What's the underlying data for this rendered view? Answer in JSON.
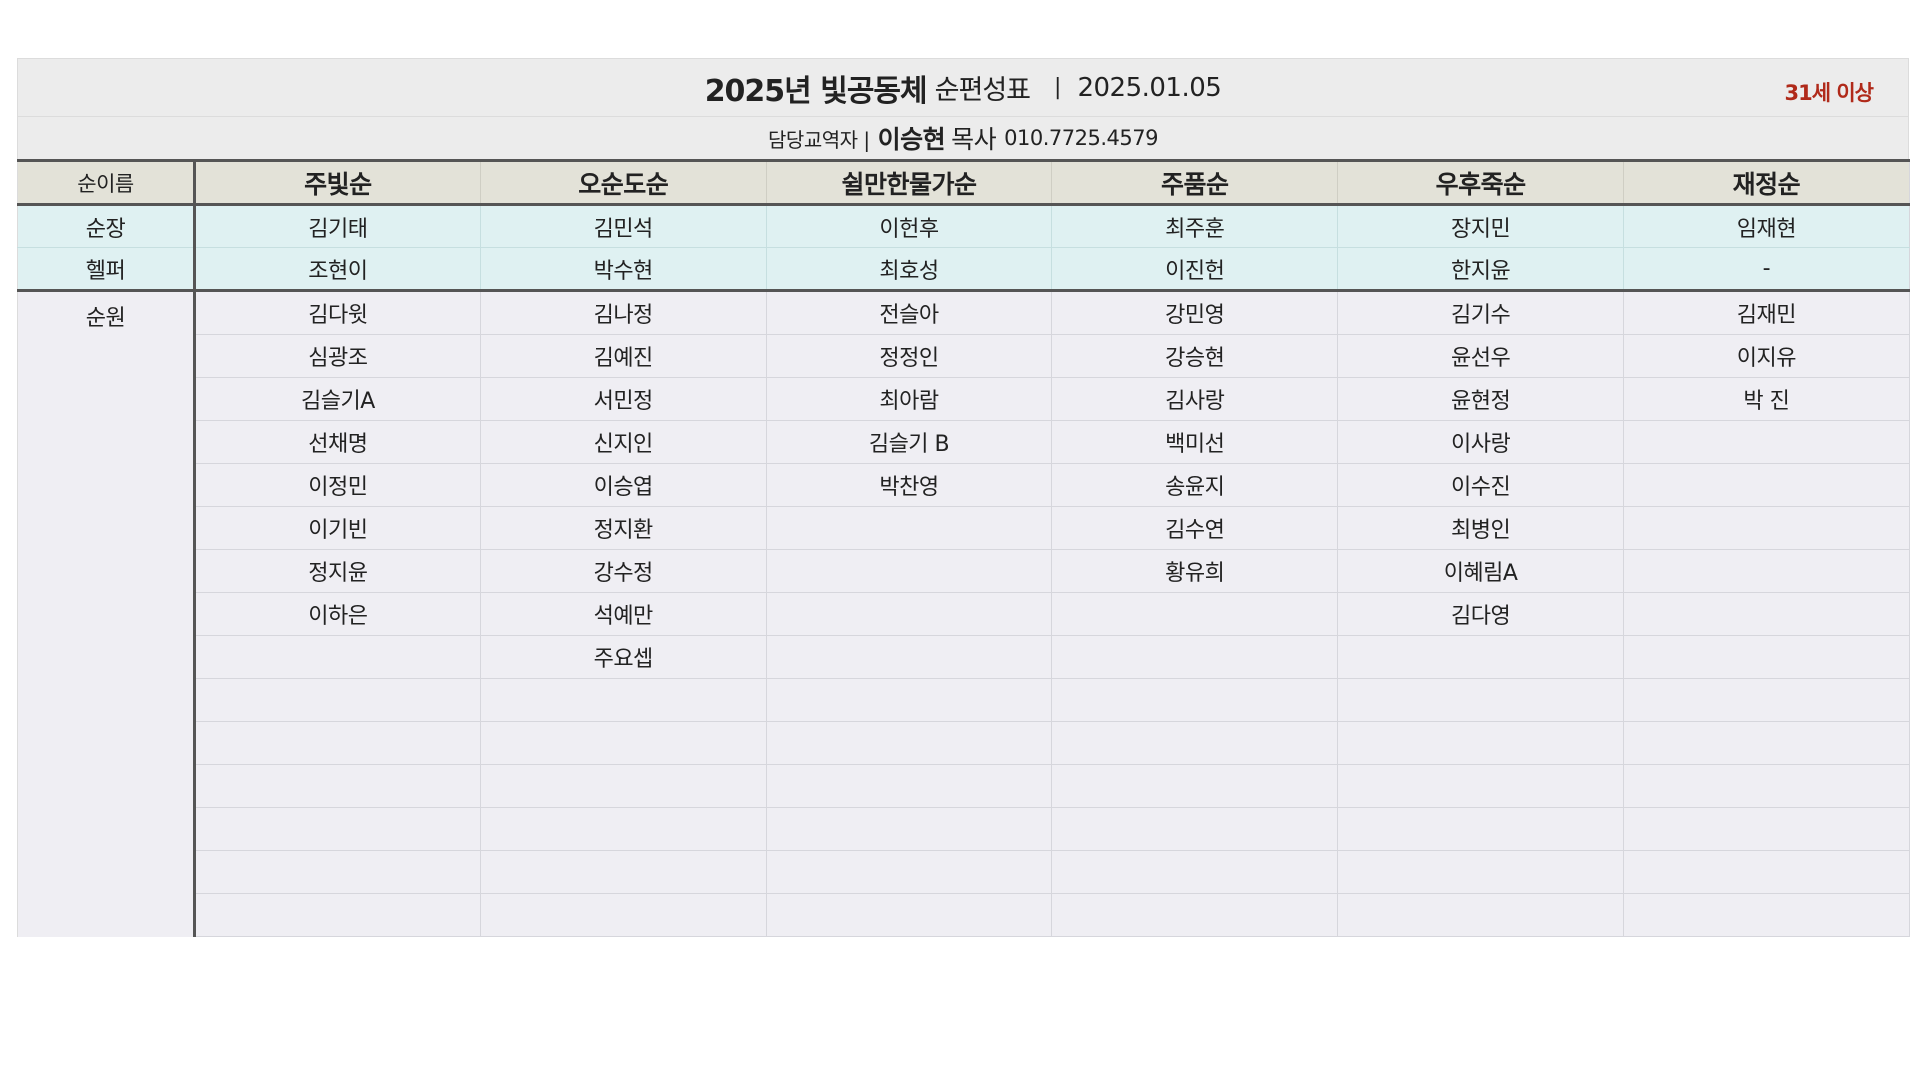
{
  "header": {
    "title_bold": "2025년 빛공동체",
    "title_rest": "순편성표",
    "separator": "|",
    "date": "2025.01.05",
    "age_tag": "31세 이상"
  },
  "leader": {
    "role_label": "담당교역자 |",
    "name": "이승현",
    "title": "목사",
    "phone": "010.7725.4579"
  },
  "table": {
    "corner_label": "순이름",
    "columns": [
      "주빛순",
      "오순도순",
      "쉴만한물가순",
      "주품순",
      "우후죽순",
      "재정순"
    ],
    "leader_rows": [
      {
        "label": "순장",
        "cells": [
          "김기태",
          "김민석",
          "이헌후",
          "최주훈",
          "장지민",
          "임재현"
        ]
      },
      {
        "label": "헬퍼",
        "cells": [
          "조현이",
          "박수현",
          "최호성",
          "이진헌",
          "한지윤",
          "-"
        ]
      }
    ],
    "member_label": "순원",
    "member_rows": [
      [
        "김다윗",
        "김나정",
        "전슬아",
        "강민영",
        "김기수",
        "김재민"
      ],
      [
        "심광조",
        "김예진",
        "정정인",
        "강승현",
        "윤선우",
        "이지유"
      ],
      [
        "김슬기A",
        "서민정",
        "최아람",
        "김사랑",
        "윤현정",
        "박  진"
      ],
      [
        "선채명",
        "신지인",
        "김슬기 B",
        "백미선",
        "이사랑",
        ""
      ],
      [
        "이정민",
        "이승엽",
        "박찬영",
        "송윤지",
        "이수진",
        ""
      ],
      [
        "이기빈",
        "정지환",
        "",
        "김수연",
        "최병인",
        ""
      ],
      [
        "정지윤",
        "강수정",
        "",
        "황유희",
        "이혜림A",
        ""
      ],
      [
        "이하은",
        "석예만",
        "",
        "",
        "김다영",
        ""
      ],
      [
        "",
        "주요셉",
        "",
        "",
        "",
        ""
      ],
      [
        "",
        "",
        "",
        "",
        "",
        ""
      ],
      [
        "",
        "",
        "",
        "",
        "",
        ""
      ],
      [
        "",
        "",
        "",
        "",
        "",
        ""
      ],
      [
        "",
        "",
        "",
        "",
        "",
        ""
      ],
      [
        "",
        "",
        "",
        "",
        "",
        ""
      ],
      [
        "",
        "",
        "",
        "",
        "",
        ""
      ]
    ]
  }
}
